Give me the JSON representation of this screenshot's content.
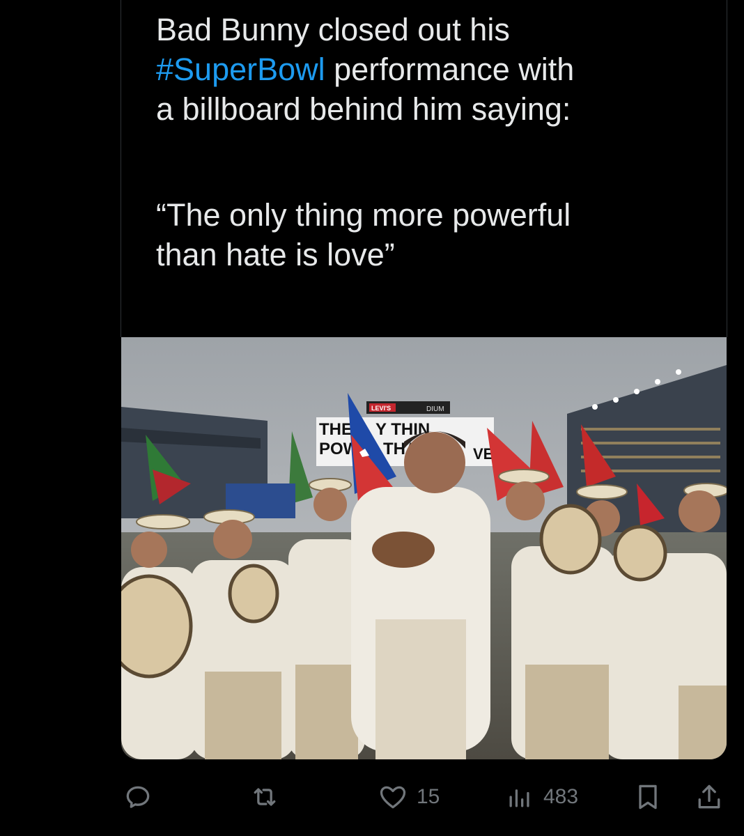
{
  "tweet": {
    "line1_prefix": "Bad Bunny closed out his",
    "hashtag": "#SuperBowl",
    "line2_suffix": " performance with",
    "line3": "a billboard behind him saying:",
    "quote_line1": "“The only thing more powerful",
    "quote_line2": "than hate is love”"
  },
  "media": {
    "billboard_left_top": "THE",
    "billboard_left_bottom": "POW",
    "billboard_mid_top": "Y THIN",
    "billboard_mid_bottom": "THAN",
    "billboard_right": "VE",
    "stadium_sign_left": "LEVI'S",
    "stadium_sign_right": "DIUM"
  },
  "actions": {
    "reply_icon": "reply-icon",
    "retweet_icon": "retweet-icon",
    "like_icon": "heart-icon",
    "like_count": "15",
    "views_icon": "views-icon",
    "views_count": "483",
    "bookmark_icon": "bookmark-icon",
    "share_icon": "share-icon"
  },
  "colors": {
    "background": "#000000",
    "text": "#e7e9ea",
    "hashtag": "#1d9bf0",
    "muted": "#71767b",
    "border": "#2f3336"
  }
}
